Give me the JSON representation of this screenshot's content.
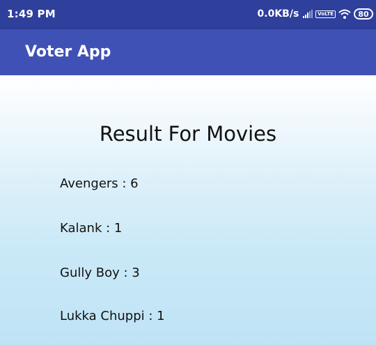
{
  "status_bar": {
    "time": "1:49 PM",
    "speed": "0.0KB/s",
    "volte": "VoLTE",
    "battery": "80",
    "icons": [
      "signal-icon",
      "volte-icon",
      "wifi-icon",
      "battery-icon"
    ]
  },
  "app_bar": {
    "title": "Voter App"
  },
  "content": {
    "title": "Result For Movies",
    "results": [
      {
        "text": "Avengers : 6"
      },
      {
        "text": "Kalank : 1"
      },
      {
        "text": "Gully Boy : 3"
      },
      {
        "text": "Lukka Chuppi : 1"
      }
    ]
  },
  "colors": {
    "status_bar": "#2f3f9c",
    "app_bar": "#3f51b5",
    "background_top": "#ffffff",
    "background_bottom": "#bfe3f6"
  }
}
